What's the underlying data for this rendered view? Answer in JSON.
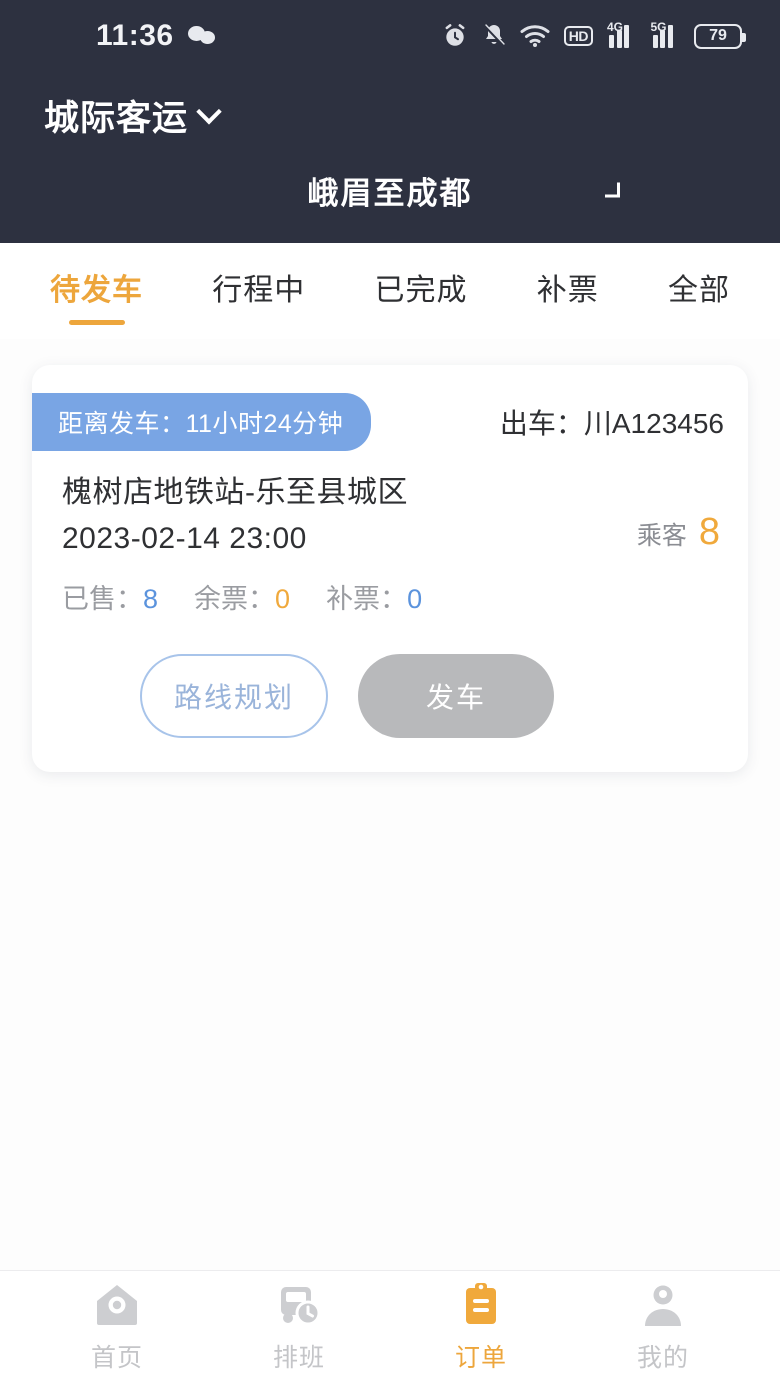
{
  "status_bar": {
    "time": "11:36",
    "icons": [
      "wechat-icon",
      "alarm-icon",
      "bell-muted-icon",
      "wifi-icon",
      "hd-icon",
      "signal-4g-icon",
      "signal-5g-icon",
      "battery-icon"
    ],
    "hd_label": "HD",
    "signal_4g_label": "4G",
    "signal_5g_label": "5G",
    "battery_level": "79"
  },
  "header": {
    "app_title": "城际客运",
    "app_title_chevron": "chevron-down-icon",
    "route_name": "峨眉至成都",
    "route_chevron": "chevron-down-icon",
    "background_color": "#2d3140"
  },
  "tabs": [
    {
      "label": "待发车",
      "active": true
    },
    {
      "label": "行程中",
      "active": false
    },
    {
      "label": "已完成",
      "active": false
    },
    {
      "label": "补票",
      "active": false
    },
    {
      "label": "全部",
      "active": false
    }
  ],
  "order_card": {
    "countdown_badge": "距离发车：11小时24分钟",
    "vehicle_label": "出车：川A123456",
    "route": "槐树店地铁站-乐至县城区",
    "depart_time": "2023-02-14 23:00",
    "passenger_label": "乘客",
    "passenger_count": "8",
    "stats": [
      {
        "label": "已售：",
        "value": "8",
        "color": "#5b93dd"
      },
      {
        "label": "余票：",
        "value": "0",
        "color": "#f0a93c"
      },
      {
        "label": "补票：",
        "value": "0",
        "color": "#5b93dd"
      }
    ],
    "primary_action": "路线规划",
    "secondary_action": "发车",
    "badge_color": "#79a5e4"
  },
  "bottom_nav": [
    {
      "label": "首页",
      "icon": "home-icon",
      "active": false
    },
    {
      "label": "排班",
      "icon": "bus-schedule-icon",
      "active": false
    },
    {
      "label": "订单",
      "icon": "clipboard-order-icon",
      "active": true
    },
    {
      "label": "我的",
      "icon": "person-icon",
      "active": false
    }
  ],
  "theme": {
    "accent": "#eda63c",
    "blue": "#5b93dd",
    "dark": "#2d3140"
  }
}
